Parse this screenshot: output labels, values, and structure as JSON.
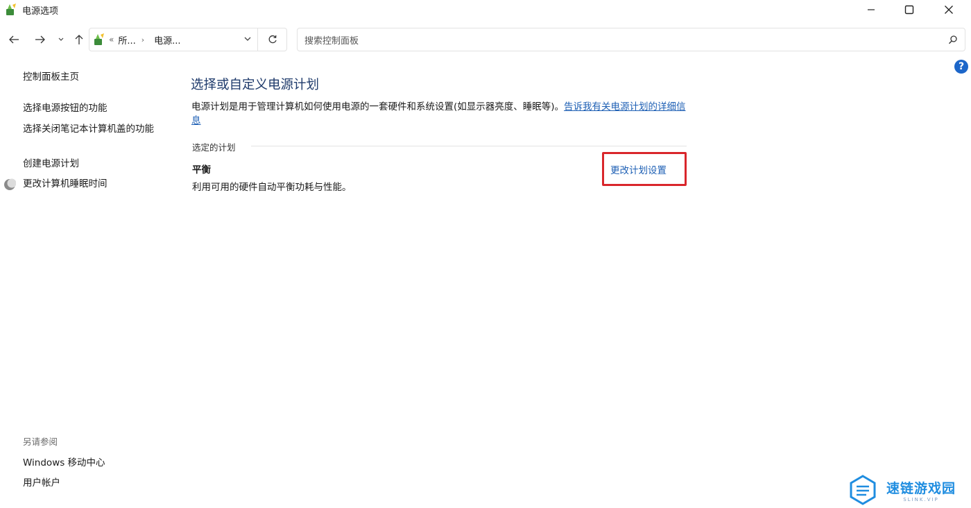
{
  "window": {
    "title": "电源选项",
    "accent": "#1d5fb4"
  },
  "address": {
    "sep": "«",
    "crumb1": "所...",
    "crumb2": "电源...",
    "chev": "›"
  },
  "search": {
    "placeholder": "搜索控制面板"
  },
  "help": {
    "label": "?"
  },
  "sidebar": {
    "home": "控制面板主页",
    "items": [
      "选择电源按钮的功能",
      "选择关闭笔记本计算机盖的功能",
      "创建电源计划",
      "更改计算机睡眠时间"
    ],
    "see_also": "另请参阅",
    "see_also_items": [
      "Windows 移动中心",
      "用户帐户"
    ]
  },
  "main": {
    "title": "选择或自定义电源计划",
    "description": "电源计划是用于管理计算机如何使用电源的一套硬件和系统设置(如显示器亮度、睡眠等)。",
    "learn_more": "告诉我有关电源计划的详细信息",
    "group_label": "选定的计划",
    "plan_name": "平衡",
    "plan_description": "利用可用的硬件自动平衡功耗与性能。",
    "change_settings": "更改计划设置",
    "highlight_color": "#d9262b"
  },
  "watermark": {
    "main": "速链游戏园",
    "sub": "SLINK.VIP"
  }
}
